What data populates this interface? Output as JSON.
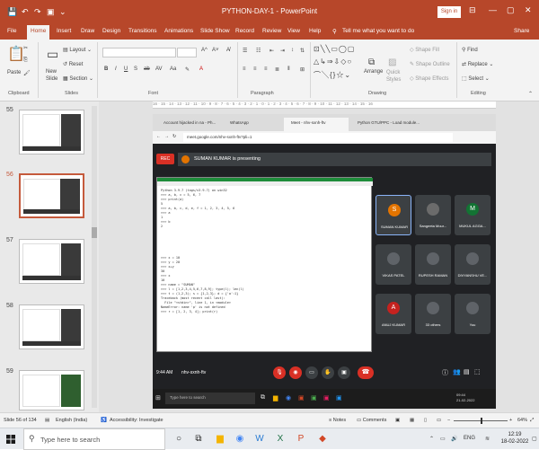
{
  "window": {
    "title": "PYTHON-DAY-1  -  PowerPoint",
    "sign_in": "Sign in",
    "controls": [
      "⊟",
      "—",
      "▢",
      "✕"
    ]
  },
  "ribbon_tabs": [
    "File",
    "Home",
    "Insert",
    "Draw",
    "Design",
    "Transitions",
    "Animations",
    "Slide Show",
    "Record",
    "Review",
    "View",
    "Help"
  ],
  "tell_me": "Tell me what you want to do",
  "share": "Share",
  "ribbon": {
    "paste": "Paste",
    "new_slide": "New Slide",
    "layout": "Layout",
    "reset": "Reset",
    "section": "Section",
    "font_size_grow": "A^",
    "font_size_shrink": "A˅",
    "arrange": "Arrange",
    "quick_styles": "Quick Styles",
    "shape_fill": "Shape Fill",
    "shape_outline": "Shape Outline",
    "shape_effects": "Shape Effects",
    "find": "Find",
    "replace": "Replace",
    "select": "Select",
    "groups": [
      "Clipboard",
      "Slides",
      "Font",
      "Paragraph",
      "Drawing",
      "Editing"
    ]
  },
  "slide_numbers": [
    "55",
    "56",
    "57",
    "58",
    "59"
  ],
  "ruler_text": "16 · 15 · 14 · 13 · 12 · 11 · 10 · 9 · 8 · 7 · 6 · 5 · 4 · 3 · 2 · 1 · 0 · 1 · 2 · 3 · 4 · 5 · 6 · 7 · 8 · 9 · 10 · 11 · 12 · 13 · 14 · 15 · 16",
  "browser": {
    "tabs": [
      "Account hijacked in na - Ph...",
      "WhatsApp",
      "Meet - nhv-sxnh-ftv",
      "Python GTU/PPC - Load module..."
    ],
    "url": "meet.google.com/nhv-sxnh-ftv?pli=1"
  },
  "meet": {
    "rec_label": "REC",
    "presenting": "SUMAN KUMAR is presenting",
    "time": "9:44 AM",
    "meeting_code": "nhv-sxnh-ftv",
    "participants": [
      {
        "name": "SUMAN KUMAR",
        "initial": "S",
        "color": "#e37400"
      },
      {
        "name": "Sangeeta Mour...",
        "initial": "",
        "color": "#6b6b6b"
      },
      {
        "name": "MUKUL AGGA...",
        "initial": "M",
        "color": "#137333"
      },
      {
        "name": "VIKAS PATEL",
        "initial": "",
        "color": "#5f6368"
      },
      {
        "name": "RUPESH RAMAN",
        "initial": "",
        "color": "#5f6368"
      },
      {
        "name": "DIVYANSHU VE...",
        "initial": "",
        "color": "#5f6368"
      },
      {
        "name": "ANUJ KUMAR",
        "initial": "A",
        "color": "#c5221f"
      },
      {
        "name": "33 others",
        "initial": "",
        "color": "#5f6368"
      },
      {
        "name": "You",
        "initial": "",
        "color": "#5f6368"
      }
    ],
    "inner_search": "Type here to search",
    "inner_clock": "09:44\n21-02-2022"
  },
  "code_lines": [
    "Python 3.9.7 (tags/v3.9.7) on win32",
    ">>> a, b, c = 5, 6, 7",
    ">>> print(a)",
    "5",
    ">>> a, b, c, d, e, f = 1, 2, 3, 4, 5, 6",
    ">>> a",
    "1",
    ">>> b",
    "2",
    "",
    "",
    "",
    "",
    "",
    "",
    ">>> x = 10",
    ">>> y = 20",
    ">>> x+y",
    "30",
    ">>> x",
    "10",
    ">>> name = \"SUMAN\"",
    ">>> l = [1,2,3,4,5,6,7,8,9]; type(l); len(l)",
    ">>> t = (1,2,3); s = {1,2,3}; d = {'a':1}",
    "Traceback (most recent call last):",
    "  File \"<stdin>\", line 1, in <module>",
    "NameError: name 'p' is not defined",
    ">>> r = [1, 2, 3, 4]; print(r)"
  ],
  "status": {
    "slide_info": "Slide 56 of 134",
    "language": "English (India)",
    "accessibility": "Accessibility: Investigate",
    "notes": "Notes",
    "comments": "Comments",
    "zoom": "64%"
  },
  "taskbar": {
    "search_placeholder": "Type here to search",
    "language": "ENG",
    "time": "12:19",
    "date": "18-02-2022"
  }
}
